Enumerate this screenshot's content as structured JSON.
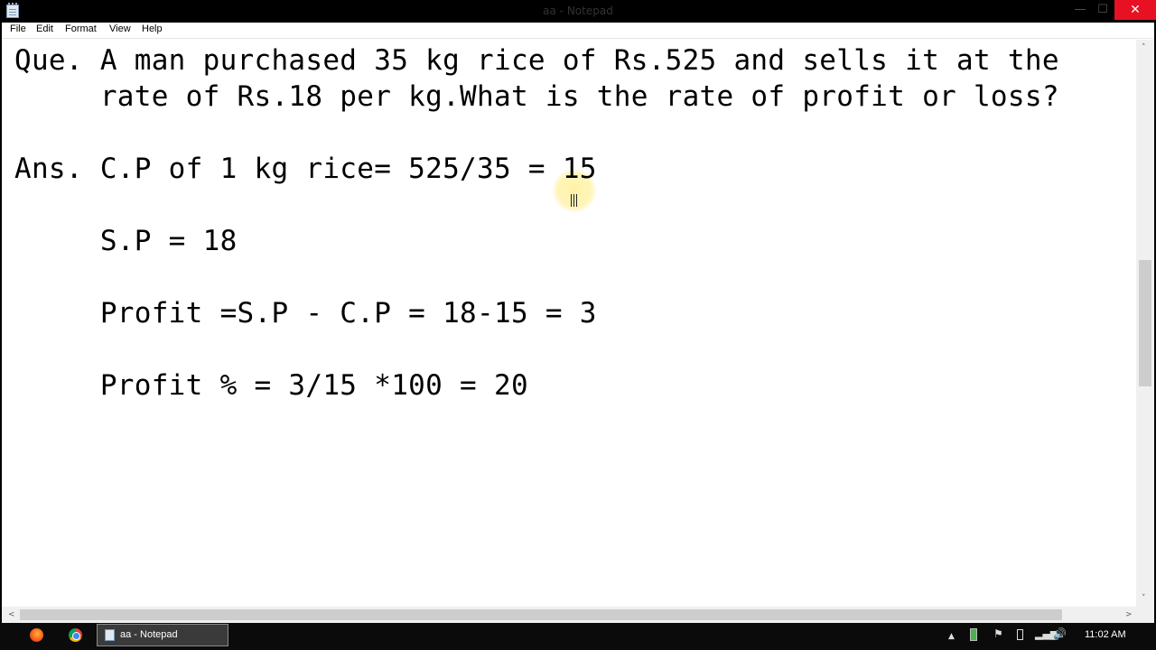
{
  "window": {
    "title": "aa - Notepad",
    "minimize_glyph": "—",
    "maximize_glyph": "☐",
    "close_glyph": "✕"
  },
  "menu": {
    "items": [
      "File",
      "Edit",
      "Format",
      "View",
      "Help"
    ]
  },
  "document": {
    "lines": [
      "Que. A man purchased 35 kg rice of Rs.525 and sells it at the",
      "     rate of Rs.18 per kg.What is the rate of profit or loss?",
      "",
      "Ans. C.P of 1 kg rice= 525/35 = 15",
      "",
      "     S.P = 18",
      "",
      "     Profit =S.P - C.P = 18-15 = 3",
      "",
      "     Profit % = 3/15 *100 = 20"
    ]
  },
  "scrollbars": {
    "up_arrow": "˄",
    "down_arrow": "˅",
    "left_arrow": "<",
    "right_arrow": ">"
  },
  "taskbar": {
    "pinned": [
      {
        "name": "firefox-icon"
      },
      {
        "name": "chrome-icon"
      }
    ],
    "active_task_label": "aa - Notepad",
    "tray": {
      "up_arrow": "▲",
      "flag": "⚑",
      "signal": "▂▄▆",
      "volume": "🔊"
    },
    "clock": "11:02 AM"
  }
}
